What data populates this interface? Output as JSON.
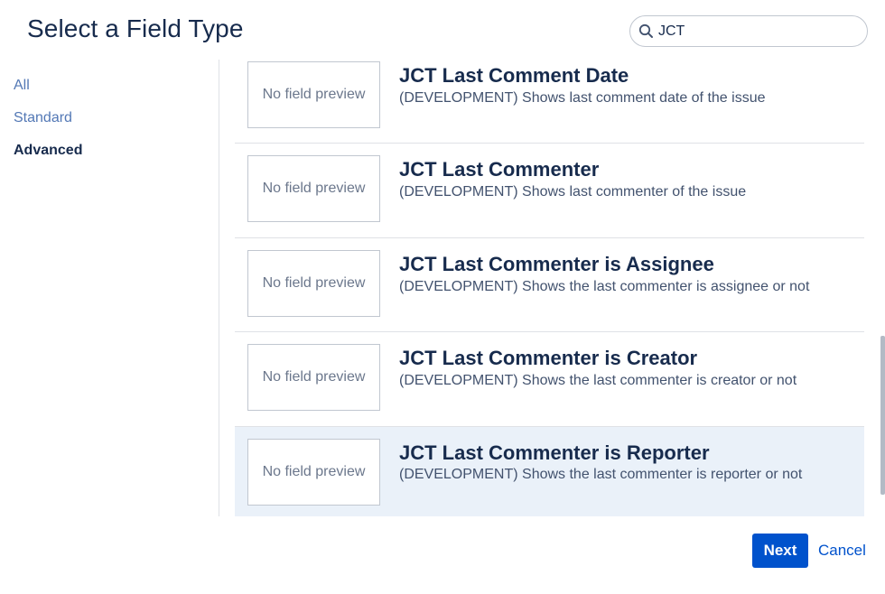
{
  "dialog": {
    "title": "Select a Field Type"
  },
  "search": {
    "value": "JCT",
    "icon": "search-icon"
  },
  "nav": {
    "items": [
      {
        "label": "All"
      },
      {
        "label": "Standard"
      },
      {
        "label": "Advanced",
        "active": true
      }
    ]
  },
  "fields": [
    {
      "preview": "No field preview",
      "title": "JCT Last Comment Date",
      "description": "(DEVELOPMENT) Shows last comment date of the issue"
    },
    {
      "preview": "No field preview",
      "title": "JCT Last Commenter",
      "description": "(DEVELOPMENT) Shows last commenter of the issue"
    },
    {
      "preview": "No field preview",
      "title": "JCT Last Commenter is Assignee",
      "description": "(DEVELOPMENT) Shows the last commenter is assignee or not"
    },
    {
      "preview": "No field preview",
      "title": "JCT Last Commenter is Creator",
      "description": "(DEVELOPMENT) Shows the last commenter is creator or not"
    },
    {
      "preview": "No field preview",
      "title": "JCT Last Commenter is Reporter",
      "description": "(DEVELOPMENT) Shows the last commenter is reporter or not",
      "selected": true
    }
  ],
  "footer": {
    "next_label": "Next",
    "cancel_label": "Cancel"
  },
  "colors": {
    "primary": "#0052cc",
    "selected_row": "#eaf1f9",
    "text": "#172b4d"
  }
}
